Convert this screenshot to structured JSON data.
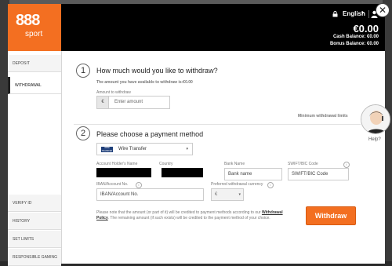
{
  "header": {
    "logo_main": "888",
    "logo_sub": "sport",
    "language": "English",
    "balance": "€0.00",
    "cash_balance": "Cash Balance: €0.00",
    "bonus_balance": "Bonus Balance: €0.00"
  },
  "sidebar": {
    "top_items": [
      {
        "label": "DEPOSIT"
      },
      {
        "label": "WITHDRAWAL"
      }
    ],
    "bottom_items": [
      {
        "label": "VERIFY ID"
      },
      {
        "label": "HISTORY"
      },
      {
        "label": "SET LIMITS"
      },
      {
        "label": "RESPONSIBLE GAMING"
      }
    ]
  },
  "step1": {
    "number": "1",
    "title": "How much would you like to withdraw?",
    "available": "The amount you have available to withdraw is:€0.00",
    "amount_label": "Amount to withdraw",
    "currency_symbol": "€",
    "amount_placeholder": "Enter amount",
    "min_limits": "Minimum withdrawal limits"
  },
  "step2": {
    "number": "2",
    "title": "Please choose a payment method",
    "method": "Wire Transfer",
    "method_logo": "WIRE TRANSFER",
    "account_holder_label": "Account Holder's Name",
    "country_label": "Country",
    "bank_name_label": "Bank Name",
    "bank_name_placeholder": "Bank name",
    "swift_label": "SWIFT/BIC Code",
    "swift_placeholder": "SWIFT/BIC Code",
    "iban_label": "IBAN/Account No.",
    "iban_placeholder": "IBAN/Account No.",
    "pref_currency_label": "Preferred withdrawal currency",
    "pref_currency_value": "€",
    "note_part1": "Please note that the amount (or part of it) will be credited to payment methods according to our",
    "note_link": "Withdrawal Policy",
    "note_part2": ". The remaining amount (if such exists) will be credited to the payment method of your choice."
  },
  "actions": {
    "withdraw": "Withdraw"
  },
  "help": {
    "label": "Help?"
  },
  "colors": {
    "brand_orange": "#f36f21",
    "header_black": "#000000"
  },
  "icons": [
    "close-icon",
    "lock-icon",
    "chevron-down-icon",
    "user-icon",
    "info-icon",
    "caret-down-icon",
    "help-agent-avatar"
  ]
}
